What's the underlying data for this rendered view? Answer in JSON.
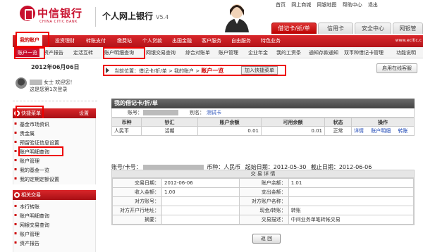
{
  "header": {
    "bank_cn": "中信银行",
    "bank_en": "CHINA CITIC BANK",
    "system_title": "个人网上银行",
    "version": "V5.4",
    "top_links": [
      "首页",
      "网上商城",
      "网银地图",
      "帮助中心",
      "退出"
    ],
    "right_tabs": [
      "借记卡/折/单",
      "信用卡",
      "安全中心",
      "网银管"
    ]
  },
  "nav": {
    "items": [
      "我的账户",
      "投资理财",
      "转账支付",
      "缴费站",
      "个人贷款",
      "出国金融",
      "客户服务",
      "自由服务",
      "特色业务"
    ],
    "url_hint": "www.ecitic.c"
  },
  "subnav": {
    "items": [
      "账户一览",
      "资产报告",
      "定活互转",
      "账户明细查询",
      "网银交易查询",
      "综合对账单",
      "账户管理",
      "企业年金",
      "我的工资条",
      "通知存款通知",
      "双币种借记卡管理",
      "功能说明"
    ]
  },
  "left": {
    "date": "2012年06月06日",
    "welcome_suffix": "女士 欢迎您！",
    "login_info": "这是您第1次登录",
    "quick_menu": {
      "title": "快捷菜单",
      "setting": "设置",
      "items": [
        "基金市场资讯",
        "贵金属",
        "预留验证信息设置",
        "账户明细查询",
        "账户管理",
        "我的基金一览",
        "我的定期定额设置"
      ]
    },
    "related": {
      "title": "相关交易",
      "items": [
        "本行转账",
        "账户明细查询",
        "网银交易查询",
        "账户管理",
        "资产报告"
      ]
    }
  },
  "main": {
    "breadcrumb_prefix": "当前位置：借记卡/折/单 > 我的账户 >",
    "breadcrumb_current": "账户一览",
    "quick_add": "加入快捷菜单",
    "online_service": "启用在线客服",
    "panel_title": "我的借记卡/折/单",
    "account_label": "账号：",
    "alias_label": "别名：",
    "alias_value": "测试卡",
    "table": {
      "headers": [
        "币种",
        "钞汇",
        "账户余额",
        "可用余额",
        "状态",
        "操作"
      ],
      "rows": [
        [
          "人民币",
          "活期",
          "0.01",
          "0.01",
          "正常"
        ]
      ],
      "ops": [
        "详情",
        "账户明细",
        "转账"
      ]
    },
    "acct_line": {
      "label": "账号/卡号：",
      "currency": "币种：人民币",
      "start": "起始日期：2012-05-30",
      "end": "截止日期：2012-06-06"
    },
    "detail": {
      "title": "交 易 详 情",
      "rows": [
        [
          "交易日期：",
          "2012-06-06",
          "账户余额：",
          "1.01"
        ],
        [
          "收入金额：",
          "1.00",
          "支出金额：",
          ""
        ],
        [
          "对方账号：",
          "",
          "对方账户名称：",
          ""
        ],
        [
          "对方开户行地址：",
          "",
          "现金/转账：",
          "转账"
        ],
        [
          "摘要：",
          "",
          "交易描述：",
          "中间业务单笔转帐交易"
        ]
      ]
    },
    "back_button": "返 回"
  }
}
